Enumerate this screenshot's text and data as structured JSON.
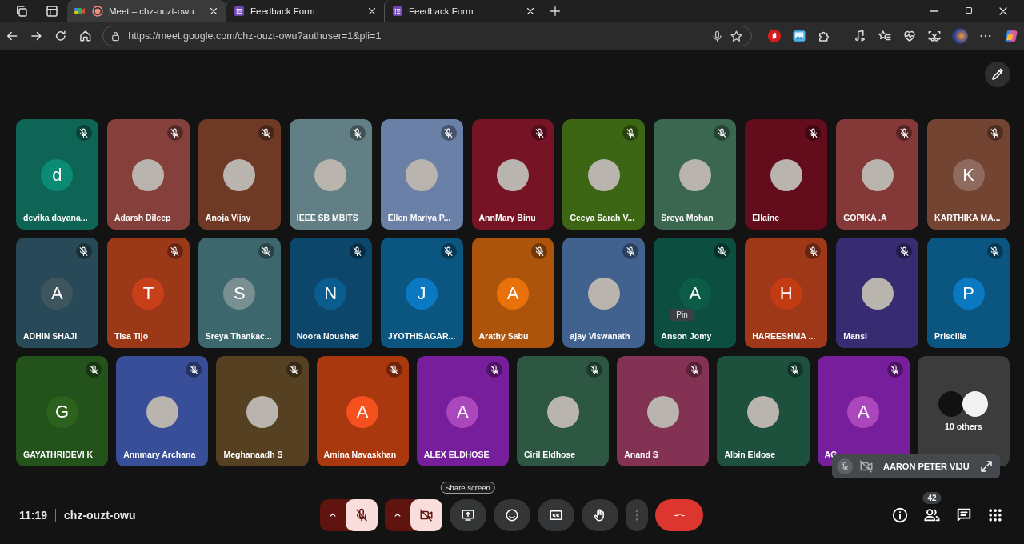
{
  "browser": {
    "tabs": [
      {
        "title": "Meet – chz-ouzt-owu",
        "kind": "meet",
        "selected": true
      },
      {
        "title": "Feedback Form",
        "kind": "form",
        "selected": false
      },
      {
        "title": "Feedback Form",
        "kind": "form",
        "selected": false
      }
    ],
    "url": "https://meet.google.com/chz-ouzt-owu?authuser=1&pli=1"
  },
  "meeting": {
    "tiles": [
      {
        "name": "devika dayana...",
        "color": "#0e6556",
        "avatar": {
          "kind": "letter",
          "letter": "d",
          "color": "#0b8a74"
        }
      },
      {
        "name": "Adarsh Dileep",
        "color": "#86403b",
        "avatar": {
          "kind": "photo"
        }
      },
      {
        "name": "Anoja Vijay",
        "color": "#6e3a26",
        "avatar": {
          "kind": "photo"
        }
      },
      {
        "name": "IEEE SB MBITS",
        "color": "#627f85",
        "avatar": {
          "kind": "photo"
        }
      },
      {
        "name": "Ellen Mariya P...",
        "color": "#6a80a6",
        "avatar": {
          "kind": "photo"
        }
      },
      {
        "name": "AnnMary Binu",
        "color": "#761426",
        "avatar": {
          "kind": "photo"
        }
      },
      {
        "name": "Ceeya Sarah V...",
        "color": "#3d6614",
        "avatar": {
          "kind": "photo"
        }
      },
      {
        "name": "Sreya Mohan",
        "color": "#3b6650",
        "avatar": {
          "kind": "photo"
        }
      },
      {
        "name": "Ellaine",
        "color": "#620c1c",
        "avatar": {
          "kind": "photo"
        }
      },
      {
        "name": "GOPIKA .A",
        "color": "#853838",
        "avatar": {
          "kind": "photo"
        }
      },
      {
        "name": "KARTHIKA MA...",
        "color": "#744432",
        "avatar": {
          "kind": "letter",
          "letter": "K",
          "color": "#8f6a5e"
        }
      },
      {
        "name": "ADHIN SHAJI",
        "color": "#284a58",
        "avatar": {
          "kind": "letter",
          "letter": "A",
          "color": "#3f555e"
        }
      },
      {
        "name": "Tisa Tijo",
        "color": "#9a3818",
        "avatar": {
          "kind": "letter",
          "letter": "T",
          "color": "#c8401a"
        }
      },
      {
        "name": "Sreya Thankac...",
        "color": "#3c676d",
        "avatar": {
          "kind": "letter",
          "letter": "S",
          "color": "#7a8f92"
        }
      },
      {
        "name": "Noora Noushad",
        "color": "#0c466a",
        "avatar": {
          "kind": "letter",
          "letter": "N",
          "color": "#0c5d8f"
        }
      },
      {
        "name": "JYOTHISAGAR...",
        "color": "#0a5680",
        "avatar": {
          "kind": "letter",
          "letter": "J",
          "color": "#0b78c2"
        }
      },
      {
        "name": "Arathy Sabu",
        "color": "#ad540c",
        "avatar": {
          "kind": "letter",
          "letter": "A",
          "color": "#e8710a"
        }
      },
      {
        "name": "ajay Viswanath",
        "color": "#41628f",
        "avatar": {
          "kind": "photo"
        }
      },
      {
        "name": "Anson Jomy",
        "color": "#0c4e3f",
        "avatar": {
          "kind": "letter",
          "letter": "A",
          "color": "#0c5d48"
        },
        "tooltip": "Pin"
      },
      {
        "name": "HAREESHMA ...",
        "color": "#9e3818",
        "avatar": {
          "kind": "letter",
          "letter": "H",
          "color": "#c23b13"
        }
      },
      {
        "name": "Mansi",
        "color": "#372c72",
        "avatar": {
          "kind": "photo"
        }
      },
      {
        "name": "Priscilla",
        "color": "#0a5680",
        "avatar": {
          "kind": "letter",
          "letter": "P",
          "color": "#0b78c2"
        }
      },
      {
        "name": "GAYATHRIDEVI K",
        "color": "#23521a",
        "avatar": {
          "kind": "letter",
          "letter": "G",
          "color": "#2c621e"
        }
      },
      {
        "name": "Annmary Archana",
        "color": "#384e98",
        "avatar": {
          "kind": "photo"
        }
      },
      {
        "name": "Meghanaadh S",
        "color": "#554022",
        "avatar": {
          "kind": "photo"
        }
      },
      {
        "name": "Amina Navaskhan",
        "color": "#a9380e",
        "avatar": {
          "kind": "letter",
          "letter": "A",
          "color": "#f4511e"
        }
      },
      {
        "name": "ALEX ELDHOSE",
        "color": "#761e9c",
        "avatar": {
          "kind": "letter",
          "letter": "A",
          "color": "#ab47bc"
        }
      },
      {
        "name": "Ciril Eldhose",
        "color": "#2d5643",
        "avatar": {
          "kind": "photo"
        }
      },
      {
        "name": "Anand S",
        "color": "#843254",
        "avatar": {
          "kind": "photo"
        }
      },
      {
        "name": "Albin Eldose",
        "color": "#1d503d",
        "avatar": {
          "kind": "photo"
        }
      },
      {
        "name": "AG",
        "color": "#761e9c",
        "avatar": {
          "kind": "letter",
          "letter": "A",
          "color": "#ab47bc"
        }
      }
    ],
    "others": {
      "label": "10 others"
    },
    "self_view": {
      "name": "AARON PETER VIJU"
    },
    "time": "11:19",
    "code": "chz-ouzt-owu",
    "controls": [
      {
        "kind": "mic",
        "on": false
      },
      {
        "kind": "camera",
        "on": false
      },
      {
        "kind": "present",
        "tooltip": "Share screen"
      },
      {
        "kind": "emoji"
      },
      {
        "kind": "captions"
      },
      {
        "kind": "hand"
      },
      {
        "kind": "more"
      },
      {
        "kind": "end"
      }
    ],
    "people_count": "42"
  }
}
